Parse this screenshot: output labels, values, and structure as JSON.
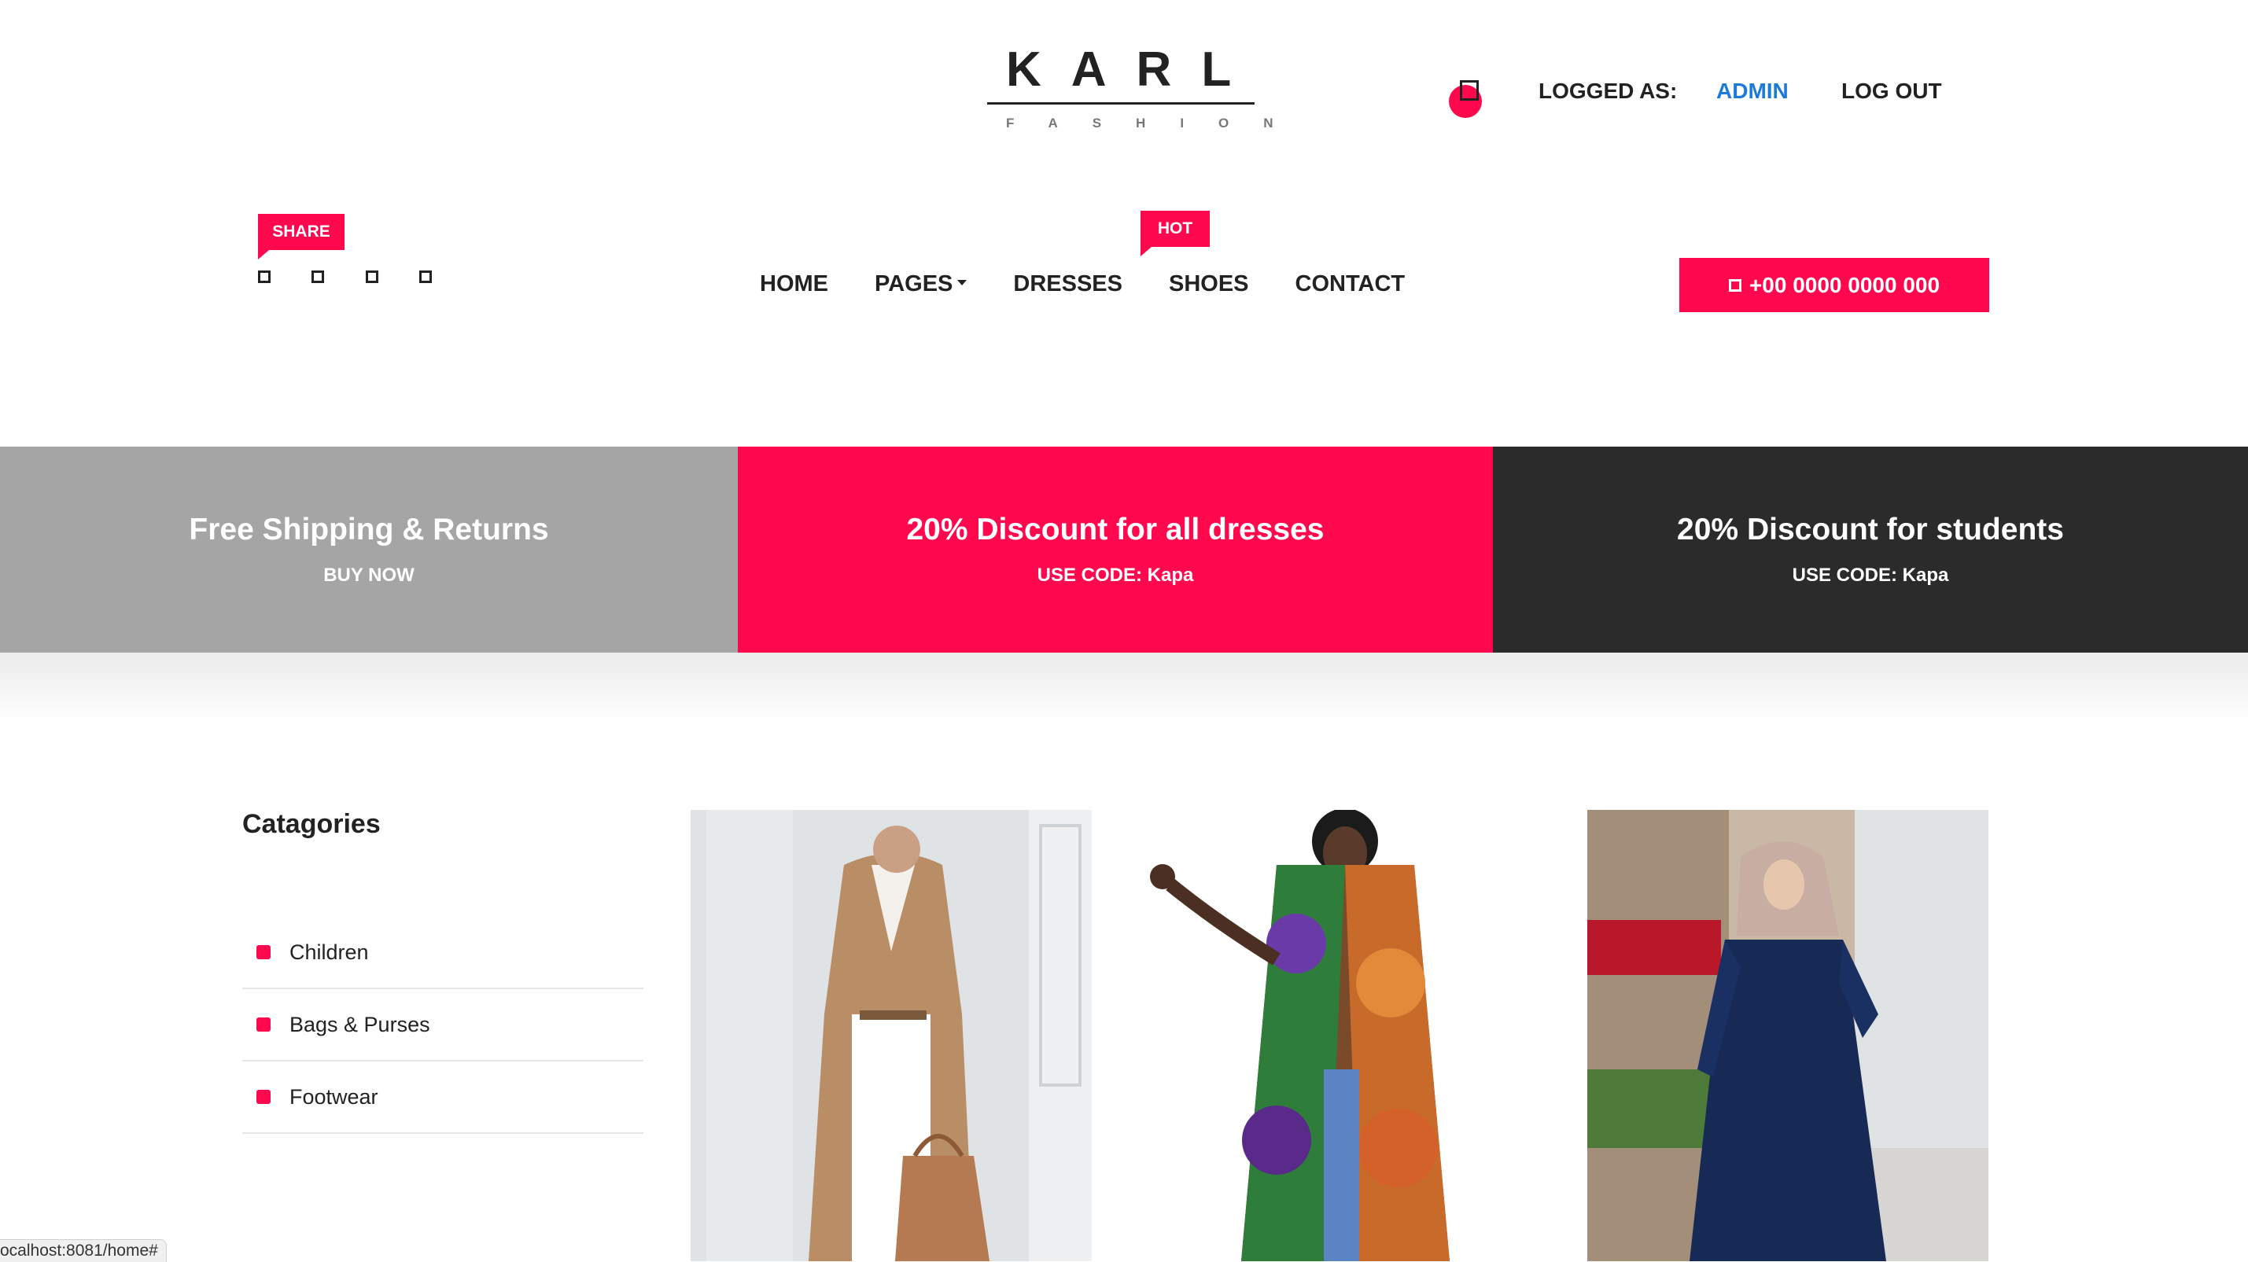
{
  "brand": {
    "name": "KARL",
    "tagline": "FASHION"
  },
  "account": {
    "logged_as_label": "LOGGED AS:",
    "user": "ADMIN",
    "logout": "LOG OUT"
  },
  "share": {
    "label": "SHARE"
  },
  "nav": {
    "home": "HOME",
    "pages": "PAGES",
    "dresses": "DRESSES",
    "shoes": "SHOES",
    "contact": "CONTACT",
    "hot_badge": "HOT"
  },
  "phone": "+00 0000 0000 000",
  "promos": [
    {
      "title": "Free Shipping & Returns",
      "sub": "BUY NOW"
    },
    {
      "title": "20% Discount for all dresses",
      "sub": "USE CODE: Kapa"
    },
    {
      "title": "20% Discount for students",
      "sub": "USE CODE: Kapa"
    }
  ],
  "categories": {
    "title": "Catagories",
    "items": [
      "Children",
      "Bags & Purses",
      "Footwear"
    ]
  },
  "status_bar": "ocalhost:8081/home#",
  "colors": {
    "accent": "#ff084e",
    "link": "#1c7bd8",
    "dark": "#2b2b2b",
    "grey": "#a5a5a5"
  }
}
